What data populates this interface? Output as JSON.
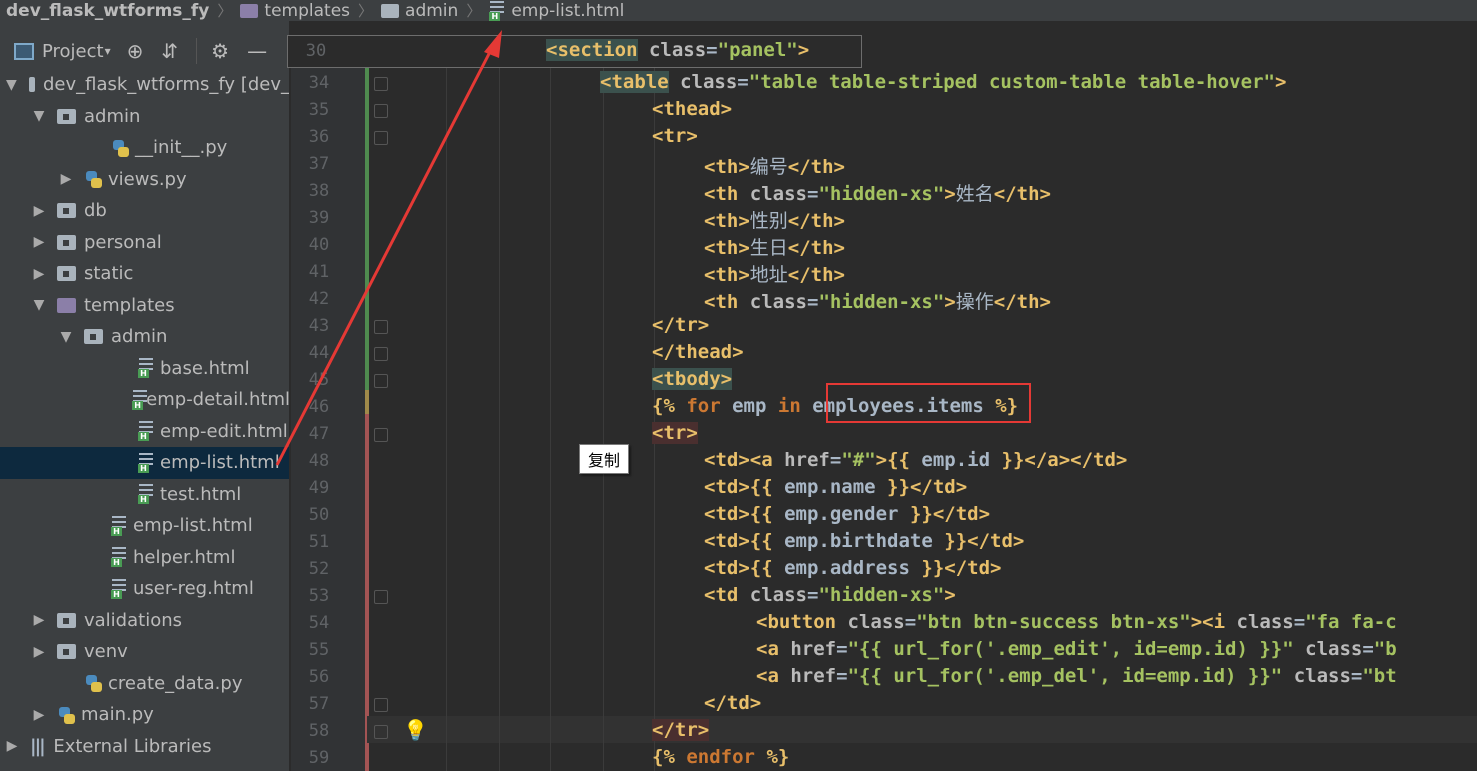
{
  "breadcrumb": {
    "project": "dev_flask_wtforms_fy",
    "folder1": "templates",
    "folder2": "admin",
    "file": "emp-list.html"
  },
  "sidebar": {
    "toolbar_label": "Project",
    "tree": [
      {
        "label": "dev_flask_wtforms_fy [dev_",
        "type": "folder",
        "level": 0,
        "expanded": true
      },
      {
        "label": "admin",
        "type": "folder",
        "level": 1,
        "expanded": true
      },
      {
        "label": "__init__.py",
        "type": "python",
        "level": 3
      },
      {
        "label": "views.py",
        "type": "python",
        "level": 2,
        "collapsed": true
      },
      {
        "label": "db",
        "type": "folder",
        "level": 1,
        "collapsed": true
      },
      {
        "label": "personal",
        "type": "folder",
        "level": 1,
        "collapsed": true
      },
      {
        "label": "static",
        "type": "folder",
        "level": 1,
        "collapsed": true
      },
      {
        "label": "templates",
        "type": "purple-folder",
        "level": 1,
        "expanded": true
      },
      {
        "label": "admin",
        "type": "folder",
        "level": 2,
        "expanded": true
      },
      {
        "label": "base.html",
        "type": "html",
        "level": 4
      },
      {
        "label": "emp-detail.html",
        "type": "html",
        "level": 4
      },
      {
        "label": "emp-edit.html",
        "type": "html",
        "level": 4
      },
      {
        "label": "emp-list.html",
        "type": "html",
        "level": 4,
        "selected": true
      },
      {
        "label": "test.html",
        "type": "html",
        "level": 4
      },
      {
        "label": "emp-list.html",
        "type": "html",
        "level": 3
      },
      {
        "label": "helper.html",
        "type": "html",
        "level": 3
      },
      {
        "label": "user-reg.html",
        "type": "html",
        "level": 3
      },
      {
        "label": "validations",
        "type": "folder",
        "level": 1,
        "collapsed": true
      },
      {
        "label": "venv",
        "type": "folder",
        "level": 1,
        "collapsed": true
      },
      {
        "label": "create_data.py",
        "type": "python",
        "level": 2
      },
      {
        "label": "main.py",
        "type": "python",
        "level": 1,
        "collapsed": true
      },
      {
        "label": "External Libraries",
        "type": "library",
        "level": 0,
        "collapsed": true
      }
    ]
  },
  "sticky": {
    "line": "30",
    "code": "<section class=\"panel\">"
  },
  "editor": {
    "lines": [
      {
        "n": "34",
        "indent": 2,
        "html": "<span class='t hl-tag'>&lt;table</span> <span class='a'>class</span>=<span class='s'>\"table table-striped custom-table table-hover\"</span><span class='t'>&gt;</span>"
      },
      {
        "n": "35",
        "indent": 3,
        "html": "<span class='t'>&lt;thead&gt;</span>"
      },
      {
        "n": "36",
        "indent": 3,
        "html": "<span class='t'>&lt;tr&gt;</span>"
      },
      {
        "n": "37",
        "indent": 4,
        "html": "<span class='t'>&lt;th&gt;</span><span class='tx'>编号</span><span class='t'>&lt;/th&gt;</span>"
      },
      {
        "n": "38",
        "indent": 4,
        "html": "<span class='t'>&lt;th</span> <span class='a'>class</span>=<span class='s'>\"hidden-xs\"</span><span class='t'>&gt;</span><span class='tx'>姓名</span><span class='t'>&lt;/th&gt;</span>"
      },
      {
        "n": "39",
        "indent": 4,
        "html": "<span class='t'>&lt;th&gt;</span><span class='tx'>性别</span><span class='t'>&lt;/th&gt;</span>"
      },
      {
        "n": "40",
        "indent": 4,
        "html": "<span class='t'>&lt;th&gt;</span><span class='tx'>生日</span><span class='t'>&lt;/th&gt;</span>"
      },
      {
        "n": "41",
        "indent": 4,
        "html": "<span class='t'>&lt;th&gt;</span><span class='tx'>地址</span><span class='t'>&lt;/th&gt;</span>"
      },
      {
        "n": "42",
        "indent": 4,
        "html": "<span class='t'>&lt;th</span> <span class='a'>class</span>=<span class='s'>\"hidden-xs\"</span><span class='t'>&gt;</span><span class='tx'>操作</span><span class='t'>&lt;/th&gt;</span>"
      },
      {
        "n": "43",
        "indent": 3,
        "html": "<span class='t'>&lt;/tr&gt;</span>"
      },
      {
        "n": "44",
        "indent": 3,
        "html": "<span class='t'>&lt;/thead&gt;</span>"
      },
      {
        "n": "45",
        "indent": 3,
        "html": "<span class='t hl-tag'>&lt;tbody&gt;</span>"
      },
      {
        "n": "46",
        "indent": 3,
        "html": "<span class='t'>{%</span> <span class='k'>for</span> emp <span class='k'>in</span> employees.items <span class='t'>%}</span>"
      },
      {
        "n": "47",
        "indent": 3,
        "html": "<span class='t hl-tag-red'>&lt;tr&gt;</span>"
      },
      {
        "n": "48",
        "indent": 4,
        "html": "<span class='t'>&lt;td&gt;&lt;a</span> <span class='a'>href</span>=<span class='s'>\"#\"</span><span class='t'>&gt;</span><span class='t'>{{</span> emp.id <span class='t'>}}</span><span class='t'>&lt;/a&gt;&lt;/td&gt;</span>"
      },
      {
        "n": "49",
        "indent": 4,
        "html": "<span class='t'>&lt;td&gt;</span><span class='t'>{{</span> emp.name <span class='t'>}}</span><span class='t'>&lt;/td&gt;</span>"
      },
      {
        "n": "50",
        "indent": 4,
        "html": "<span class='t'>&lt;td&gt;</span><span class='t'>{{</span> emp.gender <span class='t'>}}</span><span class='t'>&lt;/td&gt;</span>"
      },
      {
        "n": "51",
        "indent": 4,
        "html": "<span class='t'>&lt;td&gt;</span><span class='t'>{{</span> emp.birthdate <span class='t'>}}</span><span class='t'>&lt;/td&gt;</span>"
      },
      {
        "n": "52",
        "indent": 4,
        "html": "<span class='t'>&lt;td&gt;</span><span class='t'>{{</span> emp.address <span class='t'>}}</span><span class='t'>&lt;/td&gt;</span>"
      },
      {
        "n": "53",
        "indent": 4,
        "html": "<span class='t'>&lt;td</span> <span class='a'>class</span>=<span class='s'>\"hidden-xs\"</span><span class='t'>&gt;</span>"
      },
      {
        "n": "54",
        "indent": 5,
        "html": "<span class='t'>&lt;button</span> <span class='a'>class</span>=<span class='s'>\"btn btn-success btn-xs\"</span><span class='t'>&gt;&lt;i</span> <span class='a'>class</span>=<span class='s'>\"fa fa-c</span>"
      },
      {
        "n": "55",
        "indent": 5,
        "html": "<span class='t'>&lt;a</span> <span class='a'>href</span>=<span class='s'>\"{{ url_for('.emp_edit', id=emp.id) }}\"</span> <span class='a'>class</span>=<span class='s'>\"b</span>"
      },
      {
        "n": "56",
        "indent": 5,
        "html": "<span class='t'>&lt;a</span> <span class='a'>href</span>=<span class='s'>\"{{ url_for('.emp_del', id=emp.id) }}\"</span> <span class='a'>class</span>=<span class='s'>\"bt</span>"
      },
      {
        "n": "57",
        "indent": 4,
        "html": "<span class='t'>&lt;/td&gt;</span>"
      },
      {
        "n": "58",
        "indent": 3,
        "html": "<span class='t hl-tag-red'>&lt;/tr&gt;</span>"
      },
      {
        "n": "59",
        "indent": 3,
        "html": "<span class='t'>{%</span> <span class='k'>endfor</span> <span class='t'>%}</span>"
      }
    ]
  },
  "popup": {
    "copy_label": "复制"
  },
  "colors": {
    "annotation": "#e53935",
    "tag": "#e8bf6a",
    "string": "#a5c261",
    "keyword": "#cc7832"
  }
}
